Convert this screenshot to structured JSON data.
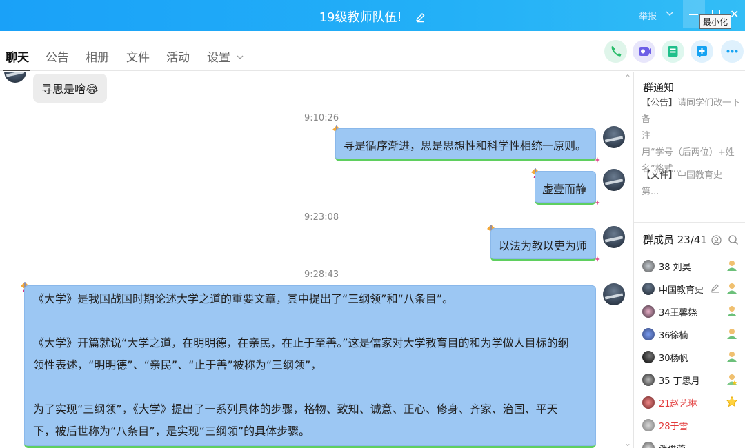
{
  "window": {
    "title": "19级教师队伍!",
    "report_label": "举报",
    "minimize_tooltip": "最小化"
  },
  "tabs": [
    {
      "label": "聊天",
      "active": true
    },
    {
      "label": "公告"
    },
    {
      "label": "相册"
    },
    {
      "label": "文件"
    },
    {
      "label": "活动"
    },
    {
      "label": "设置"
    }
  ],
  "toolbar_icons": [
    "phone-icon",
    "video-call-icon",
    "classroom-icon",
    "add-app-icon",
    "more-icon"
  ],
  "colors": {
    "titlebar": "#1fa8f7",
    "bubble_blue": "#9cc7f3",
    "bubble_gray": "#ececec",
    "bubble_underline": "#5fcf5f"
  },
  "messages": {
    "m1": {
      "text": "寻思是啥😂"
    },
    "t1": "9:10:26",
    "m2": {
      "text": "寻是循序渐进，思是思想性和科学性相统一原则。"
    },
    "m3": {
      "text": "虚壹而静"
    },
    "t2": "9:23:08",
    "m4": {
      "text": "以法为教以吏为师"
    },
    "t3": "9:28:43",
    "m5": {
      "p1": "《大学》是我国战国时期论述大学之道的重要文章，其中提出了“三纲领”和“八条目”。",
      "p2a": "《大学》开篇就说“大学之道，在明明德，在亲民，在止于至善。”这是儒家对大学教育目的和为学做人目标的纲",
      "p2b": "领性表述，“明明德”、“亲民”、“止于善”被称为“三纲领”，",
      "p3a": "为了实现“三纲领”，《大学》提出了一系列具体的步骤，格物、致知、诚意、正心、修身、齐家、治国、平天",
      "p3b": "下，被后世称为“八条目”，是实现“三纲领”的具体步骤。"
    }
  },
  "sidebar": {
    "notice_title": "群通知",
    "notice1_tag": "【公告】",
    "notice1_a": "请同学们改一下备",
    "notice1_b": "注",
    "notice1_c": "用“学号（后两位）+姓",
    "notice1_d": "名”格式...",
    "notice2_tag": "【文件】",
    "notice2_text": "中国教育史 第...",
    "members_title": "群成员 23/41",
    "members": [
      {
        "name": "38 刘昊",
        "red": false
      },
      {
        "name": "中国教育史",
        "red": false
      },
      {
        "name": "34王馨娆",
        "red": false
      },
      {
        "name": "36徐楠",
        "red": false
      },
      {
        "name": "30杨帆",
        "red": false
      },
      {
        "name": "35 丁思月",
        "red": false
      },
      {
        "name": "21赵艺琳",
        "red": true
      },
      {
        "name": "28于雪",
        "red": true
      },
      {
        "name": "潘俊萱",
        "red": false
      }
    ]
  }
}
